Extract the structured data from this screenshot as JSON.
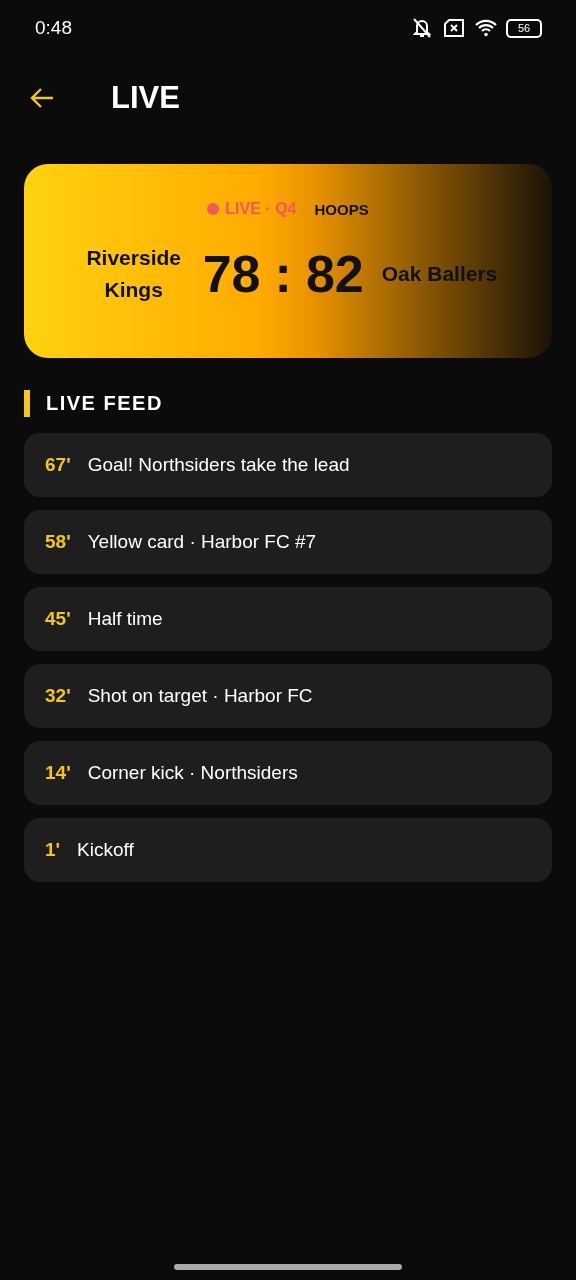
{
  "status_bar": {
    "time": "0:48",
    "battery": "56"
  },
  "header": {
    "title": "LIVE"
  },
  "score_card": {
    "status": "LIVE · Q4",
    "sport": "HOOPS",
    "home": "Riverside Kings",
    "away": "Oak Ballers",
    "home_score": "78",
    "separator": ":",
    "away_score": "82"
  },
  "feed": {
    "title": "LIVE FEED",
    "items": [
      {
        "minute": "67'",
        "text": "Goal! Northsiders take the lead"
      },
      {
        "minute": "58'",
        "text": "Yellow card · Harbor FC #7"
      },
      {
        "minute": "45'",
        "text": "Half time"
      },
      {
        "minute": "32'",
        "text": "Shot on target · Harbor FC"
      },
      {
        "minute": "14'",
        "text": "Corner kick · Northsiders"
      },
      {
        "minute": "1'",
        "text": "Kickoff"
      }
    ]
  }
}
